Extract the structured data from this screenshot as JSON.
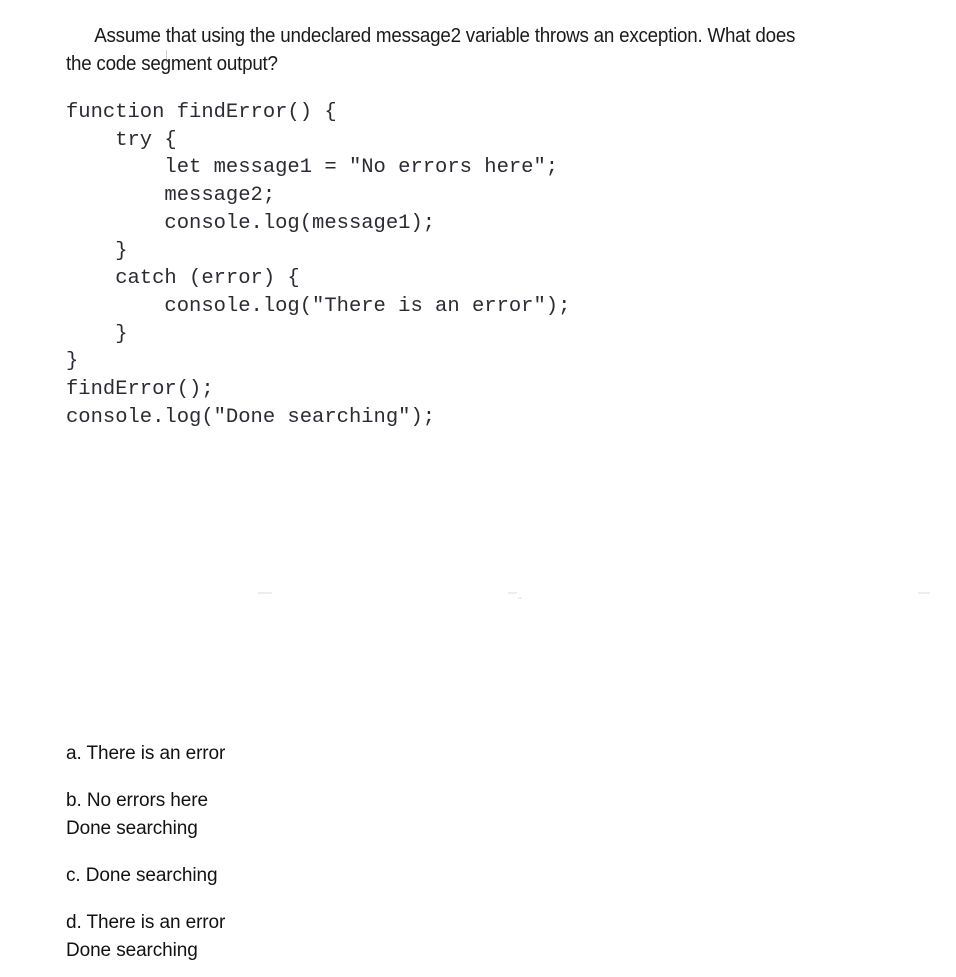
{
  "question": {
    "prompt": "Assume that using the undeclared message2 variable throws an exception. What does the code segment output?"
  },
  "code": {
    "language": "javascript",
    "text": "function findError() {\n    try {\n        let message1 = \"No errors here\";\n        message2;\n        console.log(message1);\n    }\n    catch (error) {\n        console.log(\"There is an error\");\n    }\n}\nfindError();\nconsole.log(\"Done searching\");",
    "lines": [
      "function findError() {",
      "    try {",
      "        let message1 = \"No errors here\";",
      "        message2;",
      "        console.log(message1);",
      "    }",
      "    catch (error) {",
      "        console.log(\"There is an error\");",
      "    }",
      "}",
      "findError();",
      "console.log(\"Done searching\");"
    ]
  },
  "options": [
    {
      "letter": "a.",
      "lines": [
        "a. There is an error"
      ]
    },
    {
      "letter": "b.",
      "lines": [
        "b. No errors here",
        "Done searching"
      ]
    },
    {
      "letter": "c.",
      "lines": [
        "c. Done searching"
      ]
    },
    {
      "letter": "d.",
      "lines": [
        "d. There is an error",
        "Done searching"
      ]
    }
  ],
  "colors": {
    "background": "#ffffff",
    "question_text": "#1a1a1a",
    "code_text": "#2b2b33",
    "option_text": "#121212",
    "artifact": "#ededed"
  }
}
